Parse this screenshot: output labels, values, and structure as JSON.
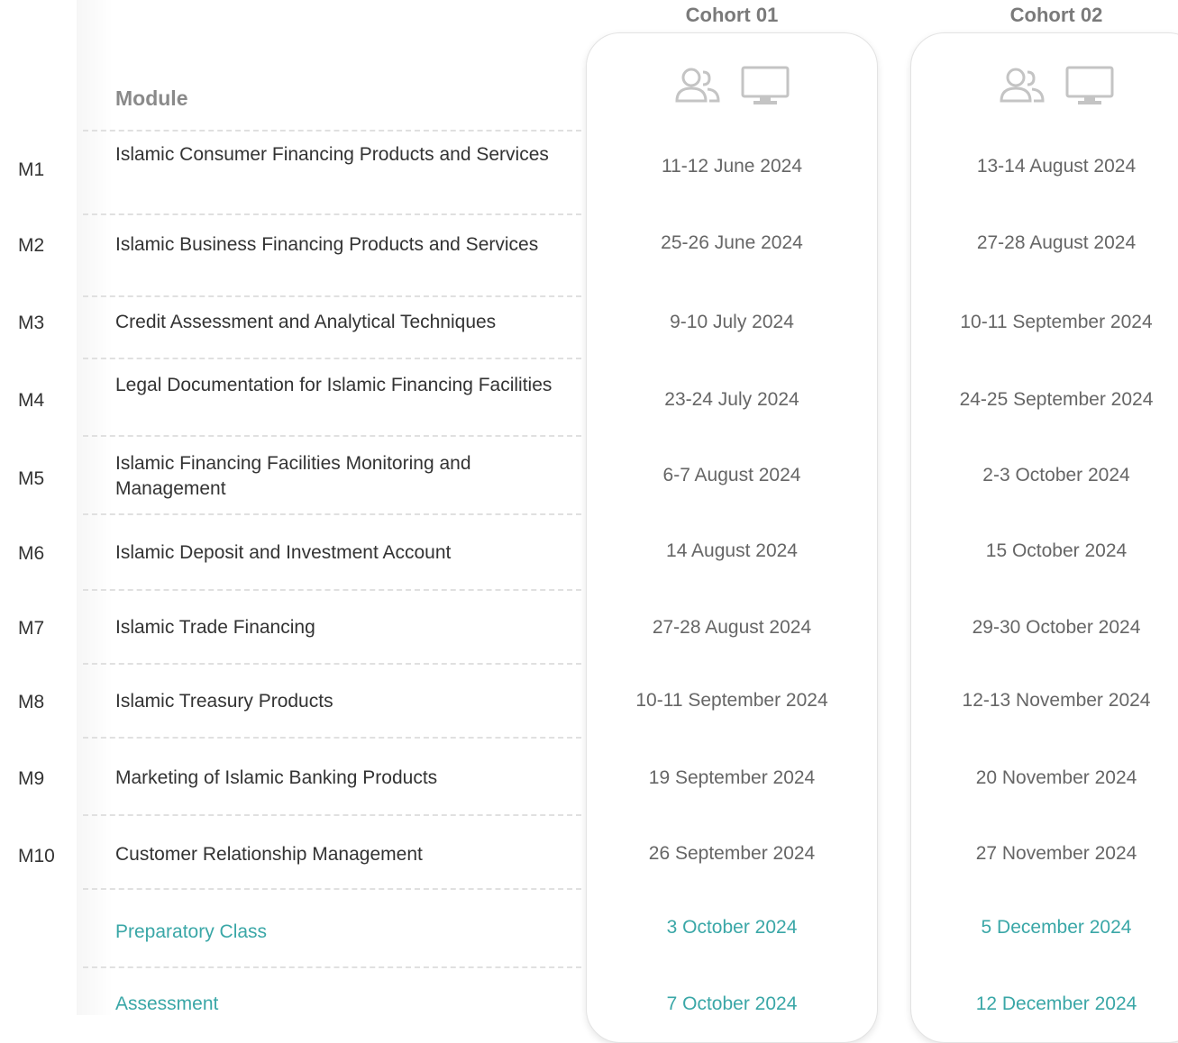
{
  "header": {
    "module_label": "Module",
    "cohorts": [
      "Cohort 01",
      "Cohort 02"
    ]
  },
  "icons": {
    "people": "group-people-icon",
    "monitor": "monitor-icon",
    "color": "#c4c4c4"
  },
  "colors": {
    "accent": "#3aa7a7",
    "text": "#333333",
    "date": "#666666"
  },
  "modules": [
    {
      "code": "M1",
      "title": "Islamic Consumer Financing Products and Services",
      "c1": "11-12 June 2024",
      "c2": "13-14 August 2024"
    },
    {
      "code": "M2",
      "title": "Islamic Business Financing Products and Services",
      "c1": "25-26 June 2024",
      "c2": "27-28 August 2024"
    },
    {
      "code": "M3",
      "title": "Credit Assessment and Analytical Techniques",
      "c1": "9-10 July 2024",
      "c2": "10-11 September 2024"
    },
    {
      "code": "M4",
      "title": "Legal Documentation for Islamic Financing Facilities",
      "c1": "23-24 July 2024",
      "c2": "24-25 September 2024"
    },
    {
      "code": "M5",
      "title": "Islamic Financing Facilities Monitoring and Management",
      "c1": "6-7 August 2024",
      "c2": "2-3 October 2024"
    },
    {
      "code": "M6",
      "title": "Islamic Deposit and Investment Account",
      "c1": "14 August 2024",
      "c2": "15 October 2024"
    },
    {
      "code": "M7",
      "title": "Islamic Trade Financing",
      "c1": "27-28 August 2024",
      "c2": "29-30 October 2024"
    },
    {
      "code": "M8",
      "title": "Islamic Treasury Products",
      "c1": "10-11 September 2024",
      "c2": "12-13 November 2024"
    },
    {
      "code": "M9",
      "title": "Marketing of Islamic Banking Products",
      "c1": "19 September 2024",
      "c2": "20 November 2024"
    },
    {
      "code": "M10",
      "title": "Customer Relationship Management",
      "c1": "26 September 2024",
      "c2": "27 November 2024"
    }
  ],
  "extras": [
    {
      "title": "Preparatory Class",
      "c1": "3 October 2024",
      "c2": "5 December 2024"
    },
    {
      "title": "Assessment",
      "c1": "7 October 2024",
      "c2": "12 December 2024"
    }
  ]
}
